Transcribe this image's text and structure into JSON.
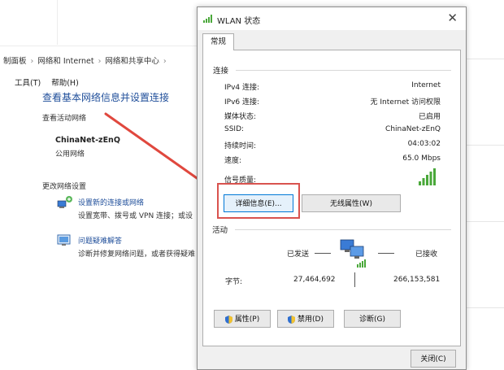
{
  "background_window": {
    "breadcrumb": [
      "制面板",
      "网络和 Internet",
      "网络和共享中心"
    ],
    "menu": [
      "工具(T)",
      "帮助(H)"
    ],
    "heading": "查看基本网络信息并设置连接",
    "active_networks_label": "查看活动网络",
    "network_name": "ChinaNet-zEnQ",
    "network_type": "公用网络",
    "change_settings_label": "更改网络设置",
    "tasks": [
      {
        "link": "设置新的连接或网络",
        "desc": "设置宽带、拨号或 VPN 连接；或设"
      },
      {
        "link": "问题疑难解答",
        "desc": "诊断并修复网络问题，或者获得疑难"
      }
    ]
  },
  "dialog": {
    "title": "WLAN 状态",
    "tab": "常规",
    "connection_group": "连接",
    "rows": [
      {
        "label": "IPv4 连接:",
        "value": "Internet"
      },
      {
        "label": "IPv6 连接:",
        "value": "无 Internet 访问权限"
      },
      {
        "label": "媒体状态:",
        "value": "已启用"
      },
      {
        "label": "SSID:",
        "value": "ChinaNet-zEnQ"
      },
      {
        "label": "持续时间:",
        "value": "04:03:02"
      },
      {
        "label": "速度:",
        "value": "65.0 Mbps"
      }
    ],
    "signal_label": "信号质量:",
    "details_button": "详细信息(E)...",
    "wireless_props_button": "无线属性(W)",
    "activity_group": "活动",
    "sent_label": "已发送",
    "received_label": "已接收",
    "bytes_label": "字节:",
    "bytes_sent": "27,464,692",
    "bytes_received": "266,153,581",
    "properties_button": "属性(P)",
    "disable_button": "禁用(D)",
    "diagnose_button": "诊断(G)",
    "close_button": "关闭(C)"
  },
  "colors": {
    "highlight_red": "#d9534f",
    "link_blue": "#1f4e9a",
    "signal_green": "#4aa83a"
  }
}
